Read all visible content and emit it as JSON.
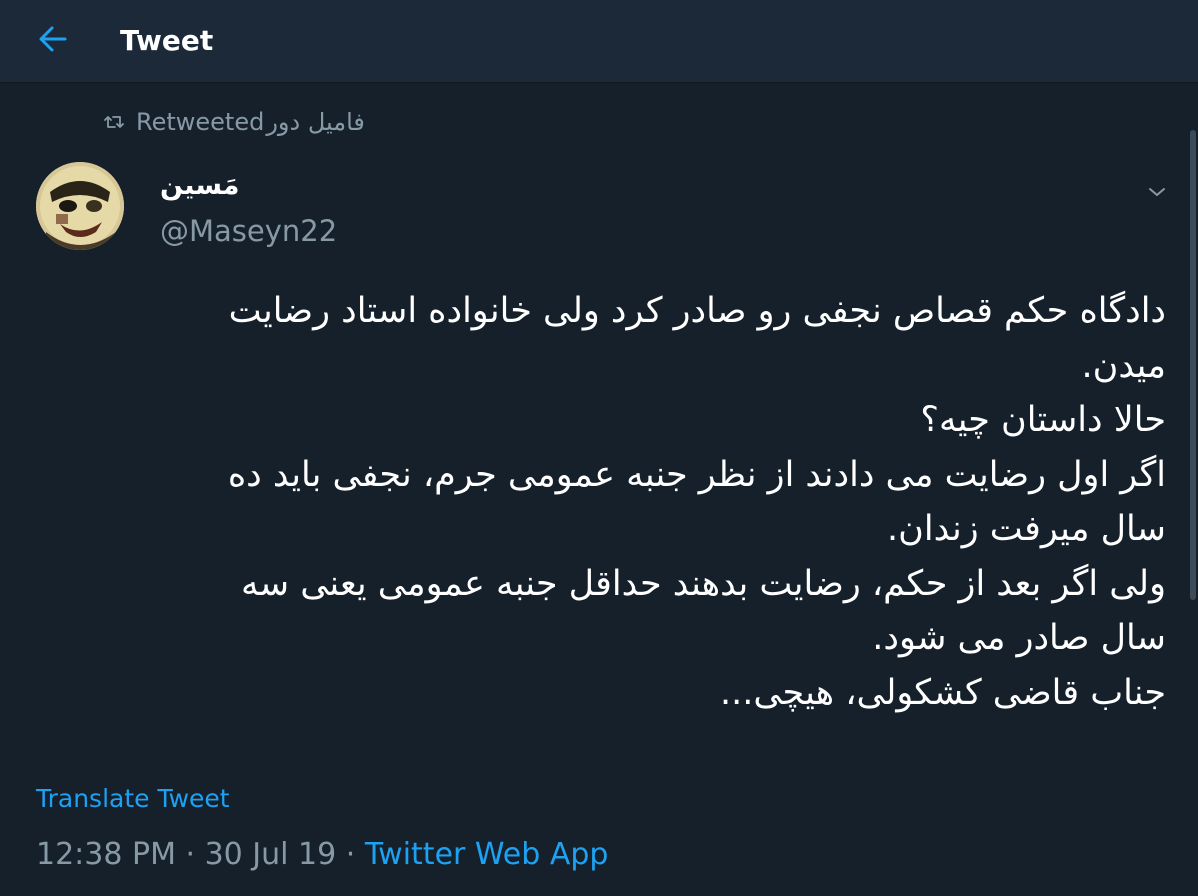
{
  "colors": {
    "background": "#15202b",
    "header_background": "#1c2938",
    "accent": "#1da1f2",
    "secondary_text": "#8899a6",
    "primary_text": "#ffffff"
  },
  "header": {
    "back_icon": "arrow-left-icon",
    "title": "Tweet"
  },
  "social_context": {
    "icon": "retweet-icon",
    "label": "Retweeted",
    "name": "فامیل دور"
  },
  "tweet": {
    "author": {
      "display_name": "مَسین",
      "handle": "@Maseyn22"
    },
    "menu_icon": "chevron-down-icon",
    "lines": [
      "دادگاه حکم قصاص نجفی رو صادر کرد ولی خانواده استاد رضایت",
      "میدن.",
      "حالا داستان چیه؟",
      "اگر اول رضایت می دادند از نظر جنبه عمومی جرم، نجفی باید ده",
      "سال میرفت زندان.",
      "ولی اگر بعد از حکم، رضایت بدهند حداقل جنبه عمومی یعنی سه",
      "سال صادر می شود.",
      "جناب قاضی کشکولی، هیچی..."
    ],
    "translate_label": "Translate Tweet",
    "time": "12:38 PM",
    "separator": " · ",
    "date": "30 Jul 19",
    "source": "Twitter Web App"
  }
}
